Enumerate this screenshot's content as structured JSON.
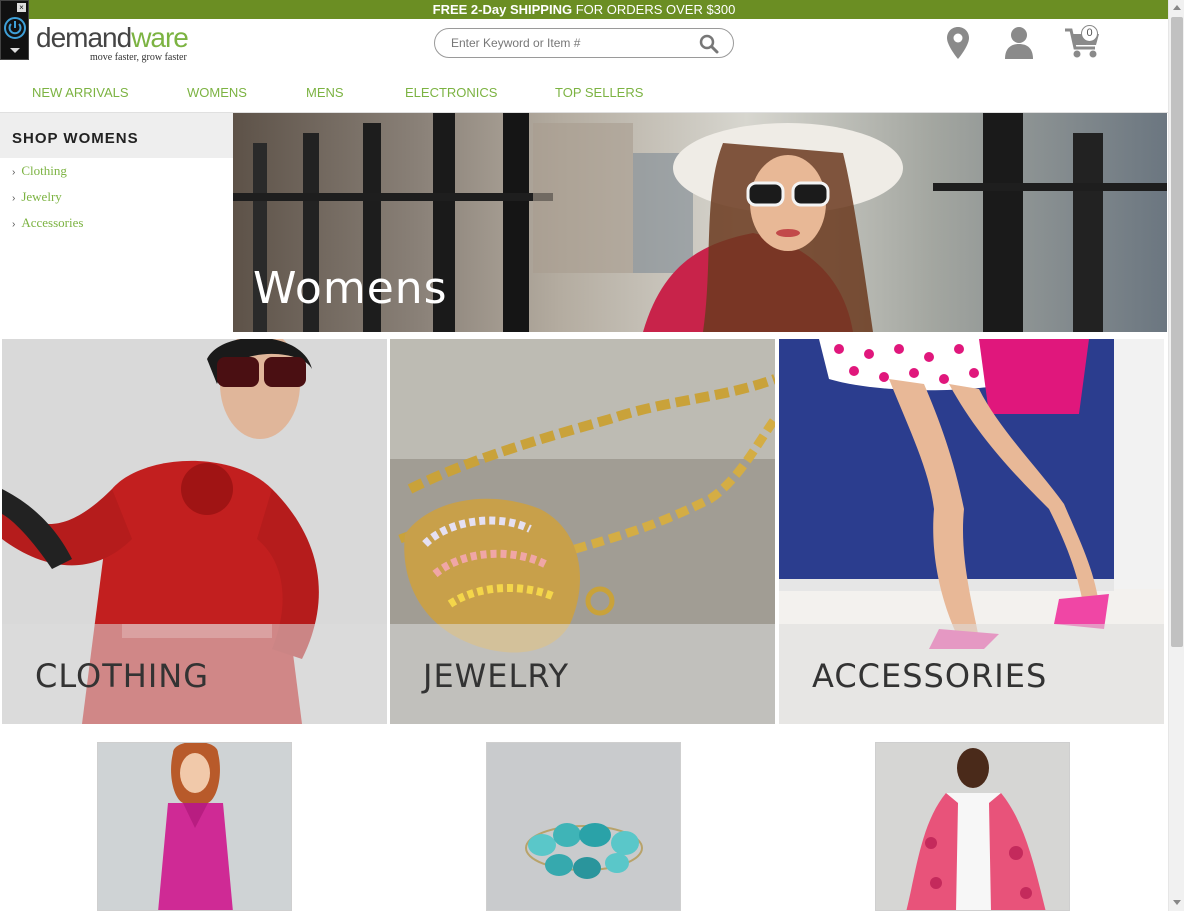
{
  "promo": {
    "strong_1": "FREE 2-Day",
    "strong_2": "SHIPPING",
    "rest": "FOR ORDERS OVER $300"
  },
  "brand": {
    "name_part1": "demand",
    "name_part2": "ware",
    "tagline": "move faster, grow faster",
    "accent_color": "#7cb342",
    "promo_color": "#6b8e23"
  },
  "search": {
    "placeholder": "Enter Keyword or Item #",
    "icon": "search-icon"
  },
  "header_icons": {
    "location": "map-pin-icon",
    "account": "user-icon",
    "cart": "cart-icon",
    "cart_count": "0"
  },
  "nav": {
    "items": [
      {
        "label": "NEW ARRIVALS"
      },
      {
        "label": "WOMENS"
      },
      {
        "label": "MENS"
      },
      {
        "label": "ELECTRONICS"
      },
      {
        "label": "TOP SELLERS"
      }
    ]
  },
  "sidebar": {
    "heading": "SHOP WOMENS",
    "items": [
      {
        "label": "Clothing"
      },
      {
        "label": "Jewelry"
      },
      {
        "label": "Accessories"
      }
    ]
  },
  "hero": {
    "title": "Womens"
  },
  "categories": [
    {
      "label": "CLOTHING"
    },
    {
      "label": "JEWELRY"
    },
    {
      "label": "ACCESSORIES"
    }
  ]
}
